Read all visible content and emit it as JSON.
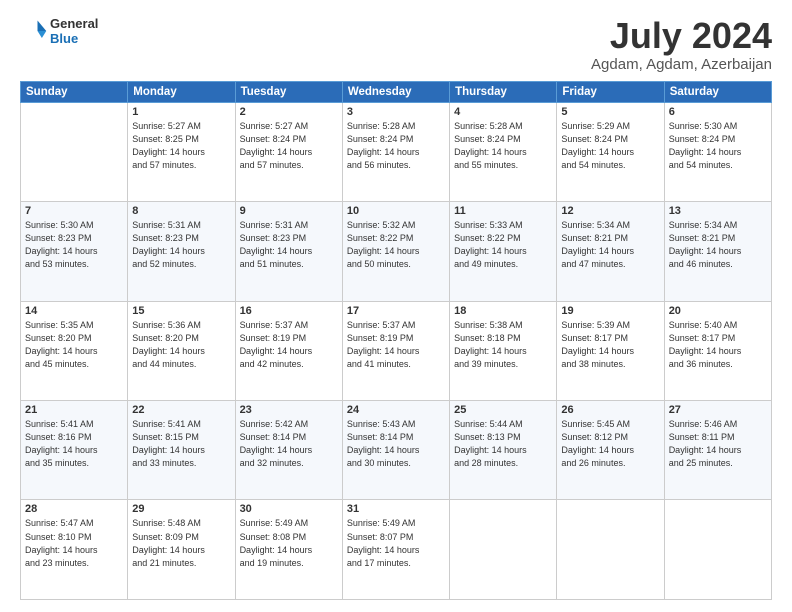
{
  "logo": {
    "general": "General",
    "blue": "Blue"
  },
  "header": {
    "month": "July 2024",
    "location": "Agdam, Agdam, Azerbaijan"
  },
  "weekdays": [
    "Sunday",
    "Monday",
    "Tuesday",
    "Wednesday",
    "Thursday",
    "Friday",
    "Saturday"
  ],
  "weeks": [
    [
      {
        "day": "",
        "info": ""
      },
      {
        "day": "1",
        "info": "Sunrise: 5:27 AM\nSunset: 8:25 PM\nDaylight: 14 hours\nand 57 minutes."
      },
      {
        "day": "2",
        "info": "Sunrise: 5:27 AM\nSunset: 8:24 PM\nDaylight: 14 hours\nand 57 minutes."
      },
      {
        "day": "3",
        "info": "Sunrise: 5:28 AM\nSunset: 8:24 PM\nDaylight: 14 hours\nand 56 minutes."
      },
      {
        "day": "4",
        "info": "Sunrise: 5:28 AM\nSunset: 8:24 PM\nDaylight: 14 hours\nand 55 minutes."
      },
      {
        "day": "5",
        "info": "Sunrise: 5:29 AM\nSunset: 8:24 PM\nDaylight: 14 hours\nand 54 minutes."
      },
      {
        "day": "6",
        "info": "Sunrise: 5:30 AM\nSunset: 8:24 PM\nDaylight: 14 hours\nand 54 minutes."
      }
    ],
    [
      {
        "day": "7",
        "info": "Sunrise: 5:30 AM\nSunset: 8:23 PM\nDaylight: 14 hours\nand 53 minutes."
      },
      {
        "day": "8",
        "info": "Sunrise: 5:31 AM\nSunset: 8:23 PM\nDaylight: 14 hours\nand 52 minutes."
      },
      {
        "day": "9",
        "info": "Sunrise: 5:31 AM\nSunset: 8:23 PM\nDaylight: 14 hours\nand 51 minutes."
      },
      {
        "day": "10",
        "info": "Sunrise: 5:32 AM\nSunset: 8:22 PM\nDaylight: 14 hours\nand 50 minutes."
      },
      {
        "day": "11",
        "info": "Sunrise: 5:33 AM\nSunset: 8:22 PM\nDaylight: 14 hours\nand 49 minutes."
      },
      {
        "day": "12",
        "info": "Sunrise: 5:34 AM\nSunset: 8:21 PM\nDaylight: 14 hours\nand 47 minutes."
      },
      {
        "day": "13",
        "info": "Sunrise: 5:34 AM\nSunset: 8:21 PM\nDaylight: 14 hours\nand 46 minutes."
      }
    ],
    [
      {
        "day": "14",
        "info": "Sunrise: 5:35 AM\nSunset: 8:20 PM\nDaylight: 14 hours\nand 45 minutes."
      },
      {
        "day": "15",
        "info": "Sunrise: 5:36 AM\nSunset: 8:20 PM\nDaylight: 14 hours\nand 44 minutes."
      },
      {
        "day": "16",
        "info": "Sunrise: 5:37 AM\nSunset: 8:19 PM\nDaylight: 14 hours\nand 42 minutes."
      },
      {
        "day": "17",
        "info": "Sunrise: 5:37 AM\nSunset: 8:19 PM\nDaylight: 14 hours\nand 41 minutes."
      },
      {
        "day": "18",
        "info": "Sunrise: 5:38 AM\nSunset: 8:18 PM\nDaylight: 14 hours\nand 39 minutes."
      },
      {
        "day": "19",
        "info": "Sunrise: 5:39 AM\nSunset: 8:17 PM\nDaylight: 14 hours\nand 38 minutes."
      },
      {
        "day": "20",
        "info": "Sunrise: 5:40 AM\nSunset: 8:17 PM\nDaylight: 14 hours\nand 36 minutes."
      }
    ],
    [
      {
        "day": "21",
        "info": "Sunrise: 5:41 AM\nSunset: 8:16 PM\nDaylight: 14 hours\nand 35 minutes."
      },
      {
        "day": "22",
        "info": "Sunrise: 5:41 AM\nSunset: 8:15 PM\nDaylight: 14 hours\nand 33 minutes."
      },
      {
        "day": "23",
        "info": "Sunrise: 5:42 AM\nSunset: 8:14 PM\nDaylight: 14 hours\nand 32 minutes."
      },
      {
        "day": "24",
        "info": "Sunrise: 5:43 AM\nSunset: 8:14 PM\nDaylight: 14 hours\nand 30 minutes."
      },
      {
        "day": "25",
        "info": "Sunrise: 5:44 AM\nSunset: 8:13 PM\nDaylight: 14 hours\nand 28 minutes."
      },
      {
        "day": "26",
        "info": "Sunrise: 5:45 AM\nSunset: 8:12 PM\nDaylight: 14 hours\nand 26 minutes."
      },
      {
        "day": "27",
        "info": "Sunrise: 5:46 AM\nSunset: 8:11 PM\nDaylight: 14 hours\nand 25 minutes."
      }
    ],
    [
      {
        "day": "28",
        "info": "Sunrise: 5:47 AM\nSunset: 8:10 PM\nDaylight: 14 hours\nand 23 minutes."
      },
      {
        "day": "29",
        "info": "Sunrise: 5:48 AM\nSunset: 8:09 PM\nDaylight: 14 hours\nand 21 minutes."
      },
      {
        "day": "30",
        "info": "Sunrise: 5:49 AM\nSunset: 8:08 PM\nDaylight: 14 hours\nand 19 minutes."
      },
      {
        "day": "31",
        "info": "Sunrise: 5:49 AM\nSunset: 8:07 PM\nDaylight: 14 hours\nand 17 minutes."
      },
      {
        "day": "",
        "info": ""
      },
      {
        "day": "",
        "info": ""
      },
      {
        "day": "",
        "info": ""
      }
    ]
  ]
}
